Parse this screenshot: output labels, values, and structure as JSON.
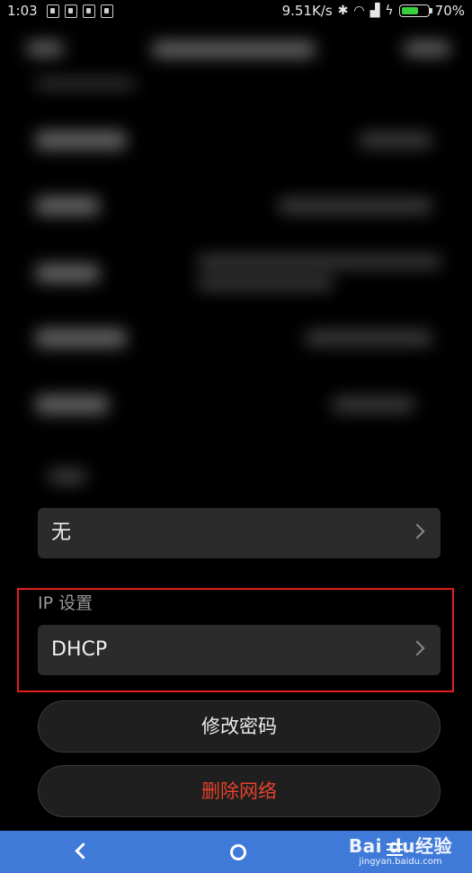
{
  "status_bar": {
    "time": "1:03",
    "network_speed": "9.51K/s",
    "battery_percent": "70%",
    "battery_level": 0.7,
    "icons": [
      "notification-icon",
      "notification-icon",
      "notification-icon",
      "notification-icon",
      "bluetooth-icon",
      "wifi-icon",
      "signal-icon",
      "charging-icon",
      "battery-icon"
    ],
    "battery_color": "#38d13e"
  },
  "proxy": {
    "value": "无"
  },
  "ip_settings": {
    "label": "IP 设置",
    "value": "DHCP"
  },
  "buttons": {
    "change_password": "修改密码",
    "delete_network": "删除网络",
    "delete_color": "#e5412b"
  },
  "nav_bar": {
    "color": "#3f7ad9",
    "icons": [
      "back-icon",
      "home-icon",
      "menu-icon"
    ]
  },
  "watermark": {
    "main": "Bai du经验",
    "sub": "jingyan.baidu.com"
  },
  "highlight_color": "#e0201b"
}
